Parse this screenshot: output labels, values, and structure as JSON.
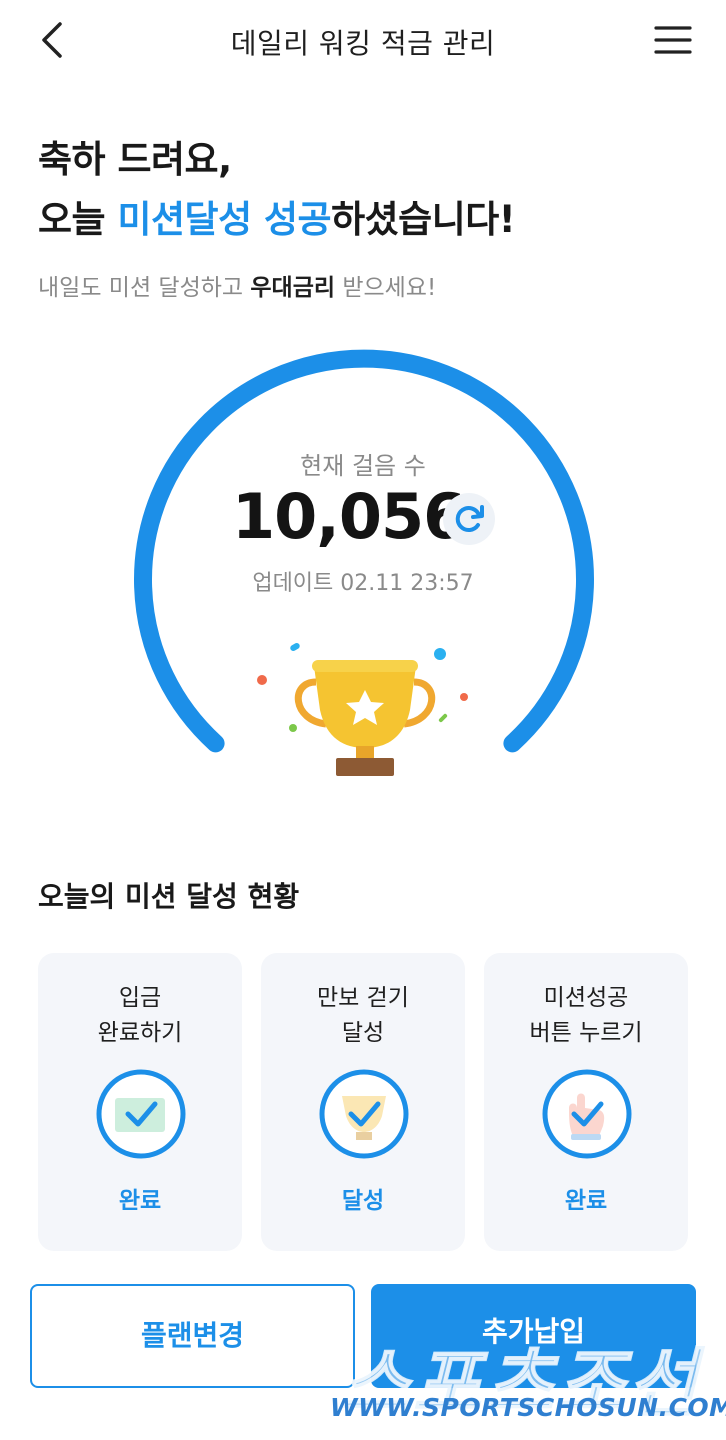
{
  "header": {
    "title": "데일리 워킹 적금 관리",
    "back_icon": "chevron-left-icon",
    "menu_icon": "hamburger-menu-icon"
  },
  "hero": {
    "line1": "축하 드려요,",
    "line2_prefix": "오늘 ",
    "line2_accent": "미션달성 성공",
    "line2_suffix": "하셨습니다!",
    "sub_prefix": "내일도 미션 달성하고 ",
    "sub_bold": "우대금리",
    "sub_suffix": " 받으세요!"
  },
  "steps": {
    "label": "현재 걸음 수",
    "value": "10,056",
    "update_text": "업데이트 02.11 23:57",
    "refresh_icon": "refresh-icon",
    "trophy_icon": "trophy-icon"
  },
  "missions": {
    "title": "오늘의 미션 달성 현황",
    "cards": [
      {
        "line1": "입금",
        "line2": "완료하기",
        "status": "완료",
        "icon": "deposit-check-icon"
      },
      {
        "line1": "만보 걷기",
        "line2": "달성",
        "status": "달성",
        "icon": "trophy-check-icon"
      },
      {
        "line1": "미션성공",
        "line2": "버튼 누르기",
        "status": "완료",
        "icon": "hand-check-icon"
      }
    ]
  },
  "actions": {
    "plan_change": "플랜변경",
    "extra_payment": "추가납입"
  },
  "watermark": {
    "logo": "스포츠조선",
    "url": "WWW.SPORTSCHOSUN.COM"
  },
  "colors": {
    "accent": "#1c8fe8",
    "card_bg": "#f4f6fa",
    "gold": "#f5c431"
  }
}
